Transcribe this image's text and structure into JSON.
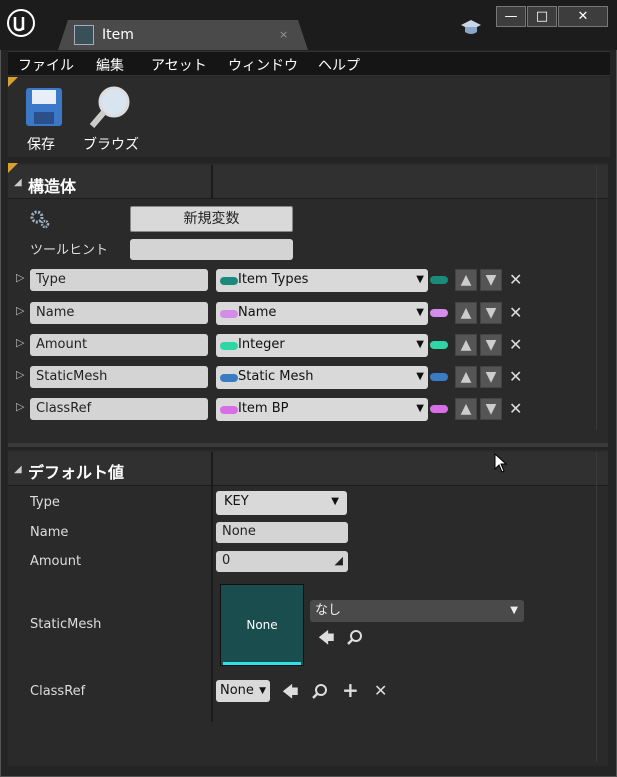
{
  "window": {
    "tab_title": "Item",
    "tab_close": "×",
    "system_buttons": [
      "—",
      "□",
      "✕"
    ]
  },
  "menu": [
    "ファイル",
    "編集",
    "アセット",
    "ウィンドウ",
    "ヘルプ"
  ],
  "toolbar": {
    "save_label": "保存",
    "browse_label": "ブラウズ"
  },
  "structure": {
    "title": "構造体",
    "new_variable": "新規変数",
    "tooltip_label": "ツールヒント",
    "tooltip_value": "",
    "members": [
      {
        "name": "Type",
        "type_name": "Item Types",
        "color": "#1a8a7a"
      },
      {
        "name": "Name",
        "type_name": "Name",
        "color": "#d48ce8"
      },
      {
        "name": "Amount",
        "type_name": "Integer",
        "color": "#2ed6a6"
      },
      {
        "name": "StaticMesh",
        "type_name": "Static Mesh",
        "color": "#3a7cc4"
      },
      {
        "name": "ClassRef",
        "type_name": "Item BP",
        "color": "#d86ee6"
      }
    ]
  },
  "defaults": {
    "title": "デフォルト値",
    "type_label": "Type",
    "type_value": "KEY",
    "name_label": "Name",
    "name_value": "None",
    "amount_label": "Amount",
    "amount_value": "0",
    "staticmesh_label": "StaticMesh",
    "staticmesh_thumb": "None",
    "staticmesh_select": "なし",
    "classref_label": "ClassRef",
    "classref_value": "None"
  }
}
